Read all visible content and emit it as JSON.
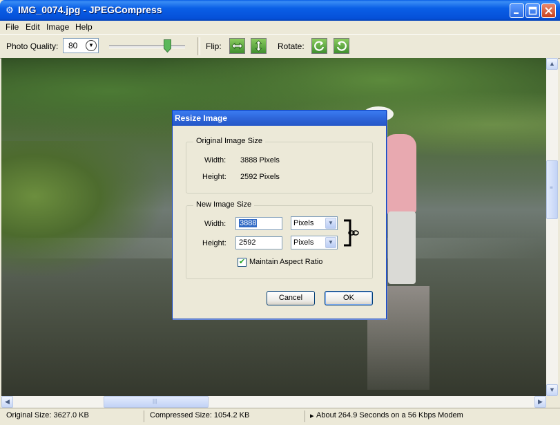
{
  "window": {
    "title": "IMG_0074.jpg - JPEGCompress"
  },
  "menu": [
    "File",
    "Edit",
    "Image",
    "Help"
  ],
  "toolbar": {
    "quality_label": "Photo Quality:",
    "quality_value": "80",
    "quality_slider_fraction": 0.8,
    "flip_label": "Flip:",
    "rotate_label": "Rotate:"
  },
  "dialog": {
    "title": "Resize Image",
    "original": {
      "legend": "Original Image Size",
      "width_label": "Width:",
      "width_value": "3888 Pixels",
      "height_label": "Height:",
      "height_value": "2592 Pixels"
    },
    "new_size": {
      "legend": "New Image Size",
      "width_label": "Width:",
      "width_value": "3888",
      "width_unit": "Pixels",
      "height_label": "Height:",
      "height_value": "2592",
      "height_unit": "Pixels",
      "maintain_label": "Maintain Aspect Ratio",
      "maintain_checked": true
    },
    "cancel_label": "Cancel",
    "ok_label": "OK"
  },
  "status": {
    "original": "Original Size: 3627.0 KB",
    "compressed": "Compressed Size: 1054.2 KB",
    "time": "About 264.9 Seconds on a 56 Kbps Modem"
  },
  "icons": {
    "flip_horizontal": "flip-horizontal-icon",
    "flip_vertical": "flip-vertical-icon",
    "rotate_left": "rotate-left-icon",
    "rotate_right": "rotate-right-icon",
    "link": "link-chain-icon"
  },
  "colors": {
    "titlebar": "#0A5FE6",
    "dialog_titlebar": "#2E66DA",
    "selection": "#316AC5"
  }
}
